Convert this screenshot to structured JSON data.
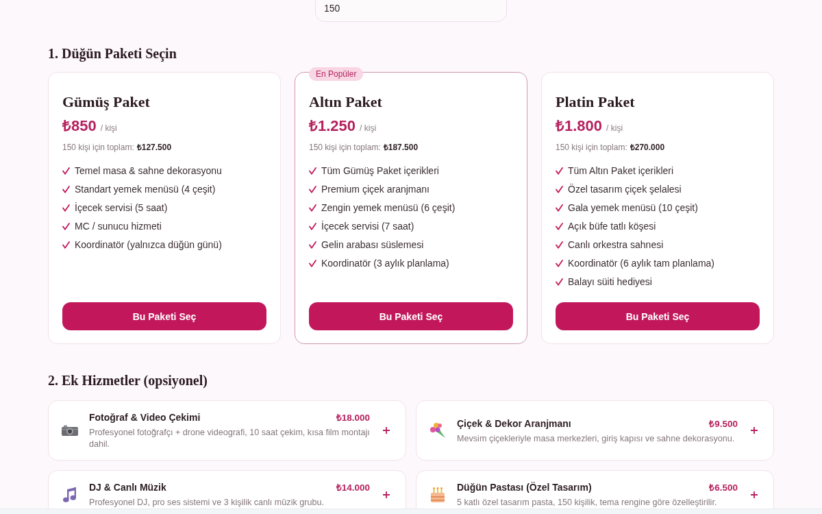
{
  "field": {
    "value": "150"
  },
  "packages_section": {
    "title": "1. Düğün Paketi Seçin",
    "packages": [
      {
        "name": "Gümüş Paket",
        "featured": false,
        "price": "₺850",
        "unit": "/ kişi",
        "total_label": "150 kişi için toplam:",
        "total": "₺127.500",
        "features": [
          "Temel masa & sahne dekorasyonu",
          "Standart yemek menüsü (4 çeşit)",
          "İçecek servisi (5 saat)",
          "MC / sunucu hizmeti",
          "Koordinatör (yalnızca düğün günü)"
        ],
        "button": "Bu Paketi Seç"
      },
      {
        "name": "Altın Paket",
        "badge": "En Popüler",
        "featured": true,
        "price": "₺1.250",
        "unit": "/ kişi",
        "total_label": "150 kişi için toplam:",
        "total": "₺187.500",
        "features": [
          "Tüm Gümüş Paket içerikleri",
          "Premium çiçek aranjmanı",
          "Zengin yemek menüsü (6 çeşit)",
          "İçecek servisi (7 saat)",
          "Gelin arabası süslemesi",
          "Koordinatör (3 aylık planlama)"
        ],
        "button": "Bu Paketi Seç"
      },
      {
        "name": "Platin Paket",
        "featured": false,
        "price": "₺1.800",
        "unit": "/ kişi",
        "total_label": "150 kişi için toplam:",
        "total": "₺270.000",
        "features": [
          "Tüm Altın Paket içerikleri",
          "Özel tasarım çiçek şelalesi",
          "Gala yemek menüsü (10 çeşit)",
          "Açık büfe tatlı köşesi",
          "Canlı orkestra sahnesi",
          "Koordinatör (6 aylık tam planlama)",
          "Balayı süiti hediyesi"
        ],
        "button": "Bu Paketi Seç"
      }
    ]
  },
  "services_section": {
    "title": "2. Ek Hizmetler (opsiyonel)",
    "services": [
      {
        "title": "Fotoğraf & Video Çekimi",
        "price": "₺18.000",
        "description": "Profesyonel fotoğrafçı + drone videografi, 10 saat çekim, kısa film montajı dahil."
      },
      {
        "title": "Çiçek & Dekor Aranjmanı",
        "price": "₺9.500",
        "description": "Mevsim çiçekleriyle masa merkezleri, giriş kapısı ve sahne dekorasyonu."
      },
      {
        "title": "DJ & Canlı Müzik",
        "price": "₺14.000",
        "description": "Profesyonel DJ, pro ses sistemi ve 3 kişilik canlı müzik grubu."
      },
      {
        "title": "Düğün Pastası (Özel Tasarım)",
        "price": "₺6.500",
        "description": "5 katlı özel tasarım pasta, 150 kişilik, tema rengine göre özelleştirilir."
      }
    ]
  }
}
